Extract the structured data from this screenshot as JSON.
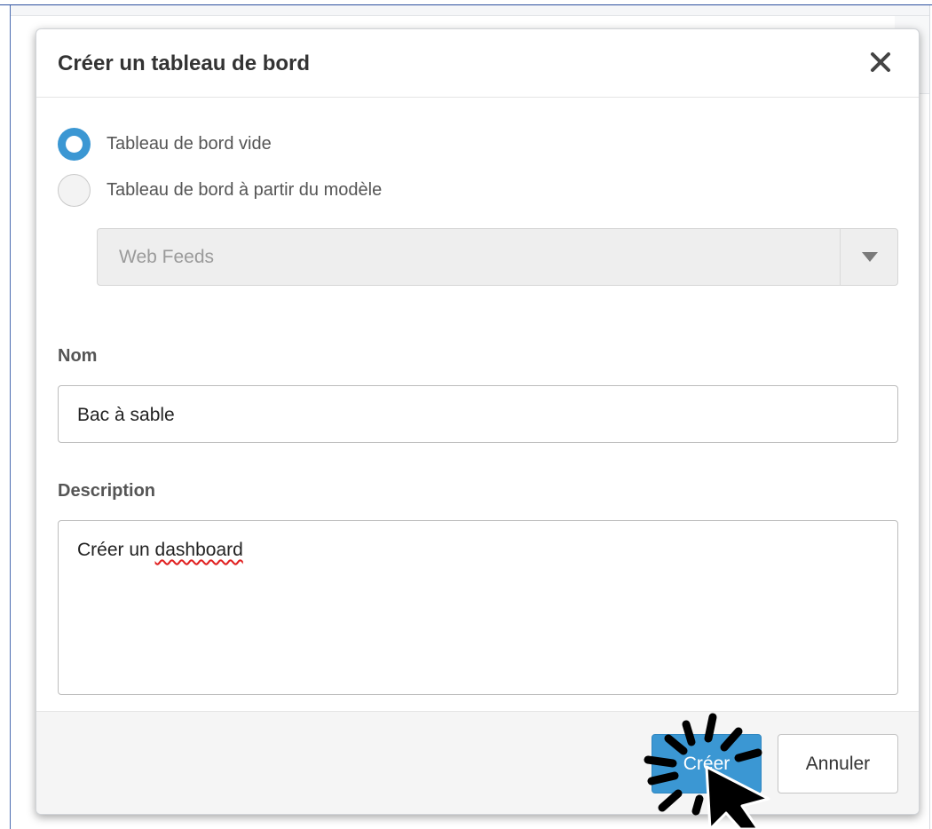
{
  "dialog": {
    "title": "Créer un tableau de bord",
    "close_icon": "close-icon"
  },
  "dashboard_type": {
    "options": [
      {
        "label": "Tableau de bord vide",
        "selected": true
      },
      {
        "label": "Tableau de bord à partir du modèle",
        "selected": false
      }
    ],
    "template_select": {
      "value": "Web Feeds",
      "disabled": true,
      "arrow_icon": "caret-down-icon"
    }
  },
  "form": {
    "name_label": "Nom",
    "name_value": "Bac à sable",
    "description_label": "Description",
    "description_prefix": "Créer un ",
    "description_misspelled": "dashboard"
  },
  "footer": {
    "create_label": "Créer",
    "cancel_label": "Annuler"
  },
  "colors": {
    "primary": "#3b97d3",
    "spellcheck_underline": "#e02020"
  }
}
